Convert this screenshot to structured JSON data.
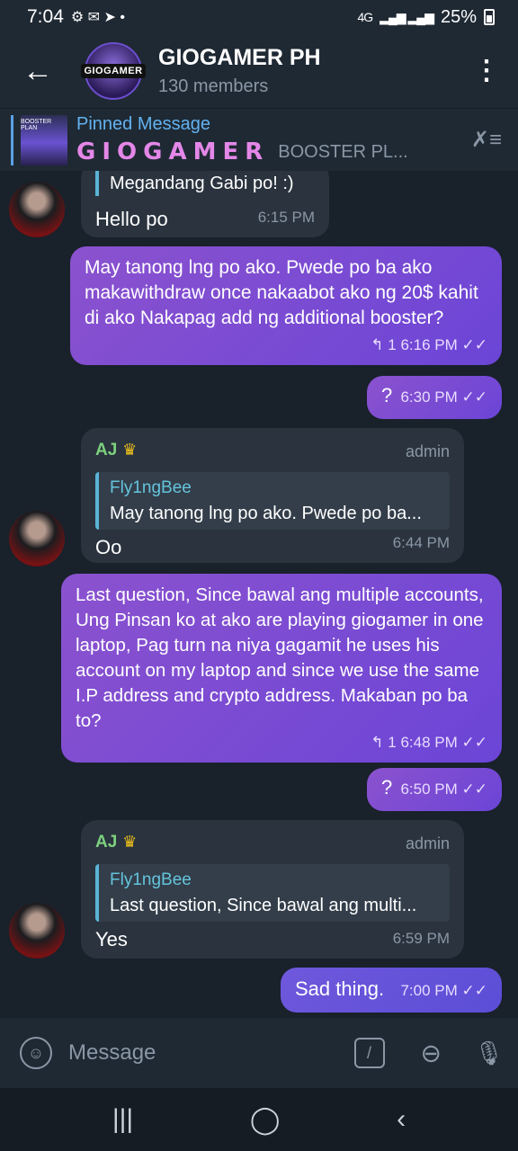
{
  "status_bar": {
    "time": "7:04",
    "network": "4G",
    "battery": "25%"
  },
  "header": {
    "title": "GIOGAMER PH",
    "subtitle": "130 members",
    "avatar_text": "GIOGAMER"
  },
  "pinned": {
    "title": "Pinned Message",
    "logo_text": "GIOGAMER",
    "snippet": "BOOSTER PL...",
    "thumb_text": "BOOSTER PLAN"
  },
  "messages": [
    {
      "text": "Megandang Gabi po! :)",
      "sub": "Hello po",
      "time": "6:15 PM"
    },
    {
      "text": "May tanong lng po ako. Pwede po ba ako makawithdraw once nakaabot ako ng 20$ kahit di ako Nakapag add ng additional booster?",
      "replies": "1",
      "time": "6:16 PM"
    },
    {
      "text": "?",
      "time": "6:30 PM"
    },
    {
      "sender": "AJ",
      "role": "admin",
      "quote_name": "Fly1ngBee",
      "quote_text": "May tanong lng po ako. Pwede po ba...",
      "text": "Oo",
      "time": "6:44 PM"
    },
    {
      "text": "Last question, Since bawal ang multiple accounts, Ung Pinsan ko at ako are playing giogamer in one laptop, Pag turn na niya gagamit he uses his account on my laptop and since we use the same I.P address and crypto address. Makaban po ba to?",
      "replies": "1",
      "time": "6:48 PM"
    },
    {
      "text": "?",
      "time": "6:50 PM"
    },
    {
      "sender": "AJ",
      "role": "admin",
      "quote_name": "Fly1ngBee",
      "quote_text": "Last question, Since bawal ang multi...",
      "text": "Yes",
      "time": "6:59 PM"
    },
    {
      "text": "Sad thing.",
      "time": "7:00 PM"
    }
  ],
  "input": {
    "placeholder": "Message"
  },
  "icons": [
    "back-arrow-icon",
    "more-vert-icon",
    "unpin-icon",
    "emoji-icon",
    "command-icon",
    "attach-icon",
    "mic-icon",
    "reply-icon",
    "double-check-icon",
    "crown-icon"
  ]
}
